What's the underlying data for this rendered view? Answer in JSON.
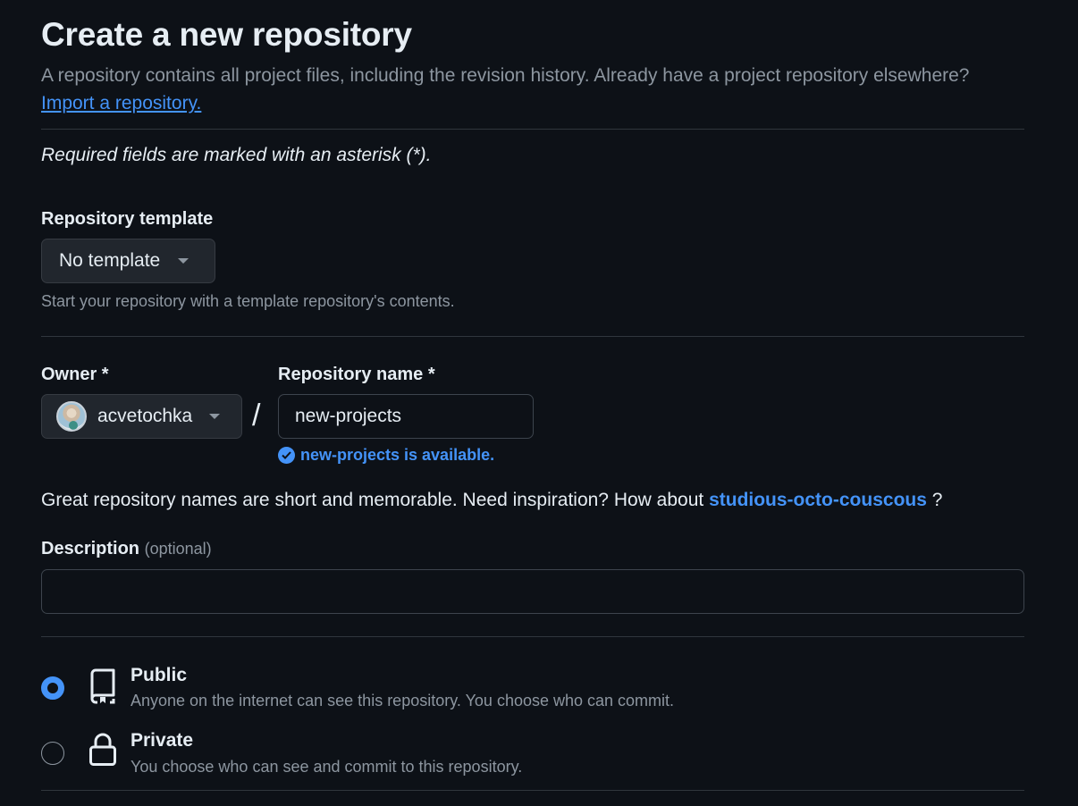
{
  "header": {
    "title": "Create a new repository",
    "subtitle": "A repository contains all project files, including the revision history. Already have a project repository elsewhere?",
    "import_link": "Import a repository."
  },
  "required_note": "Required fields are marked with an asterisk (*).",
  "template": {
    "label": "Repository template",
    "selected": "No template",
    "help": "Start your repository with a template repository's contents."
  },
  "owner": {
    "label": "Owner *",
    "selected": "acvetochka"
  },
  "separator": "/",
  "repo_name": {
    "label": "Repository name *",
    "value": "new-projects",
    "availability": "new-projects is available."
  },
  "inspiration": {
    "text": "Great repository names are short and memorable. Need inspiration? How about",
    "suggestion": "studious-octo-couscous",
    "end": "?"
  },
  "description": {
    "label": "Description",
    "optional": "(optional)",
    "value": ""
  },
  "visibility": {
    "options": [
      {
        "title": "Public",
        "desc": "Anyone on the internet can see this repository. You choose who can commit.",
        "checked": true,
        "icon": "repo-icon"
      },
      {
        "title": "Private",
        "desc": "You choose who can see and commit to this repository.",
        "checked": false,
        "icon": "lock-icon"
      }
    ]
  },
  "colors": {
    "background": "#0d1117",
    "accent": "#4493f8",
    "muted": "#8d96a0",
    "border": "#30363d"
  }
}
